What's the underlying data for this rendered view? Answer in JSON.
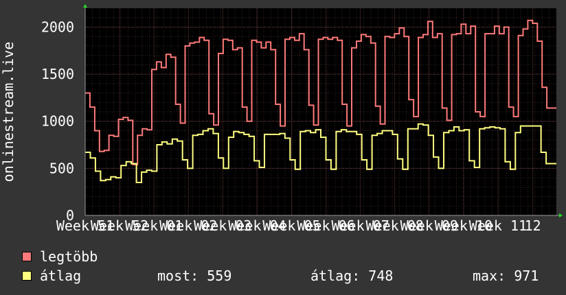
{
  "chart_data": {
    "type": "line",
    "ylabel": "onlinestream.live",
    "ylim": [
      0,
      2200
    ],
    "yticks": [
      0,
      500,
      1000,
      1500,
      2000
    ],
    "xlim": [
      0,
      100
    ],
    "xtick_labels": [
      "Week 51",
      "Week 52",
      "Week 01",
      "Week 02",
      "Week 03",
      "Week 04",
      "Week 05",
      "Week 06",
      "Week 07",
      "Week 08",
      "Week 09",
      "Week 10",
      "Week 11",
      "12"
    ],
    "xtick_positions": [
      0,
      7.3,
      14.6,
      21.9,
      29.2,
      36.5,
      43.8,
      51.1,
      58.4,
      65.7,
      73.0,
      80.3,
      87.6,
      95
    ],
    "grid": true,
    "series": [
      {
        "name": "legtöbb",
        "color": "#ff7a7a",
        "values": [
          1300,
          1150,
          900,
          680,
          690,
          850,
          840,
          1020,
          1040,
          1010,
          540,
          850,
          920,
          910,
          1550,
          1630,
          1570,
          1710,
          1680,
          1180,
          980,
          1800,
          1830,
          1840,
          1890,
          1860,
          1080,
          960,
          1720,
          1870,
          1860,
          1760,
          1780,
          1150,
          1000,
          1860,
          1840,
          1780,
          1840,
          1760,
          1180,
          950,
          1870,
          1890,
          1860,
          1930,
          1760,
          1170,
          960,
          1870,
          1890,
          1870,
          1890,
          1860,
          1180,
          950,
          1780,
          1850,
          1920,
          1900,
          1830,
          1160,
          970,
          1900,
          1890,
          1930,
          1990,
          1900,
          1230,
          1050,
          1890,
          1920,
          2060,
          1890,
          1930,
          1140,
          1010,
          1920,
          1930,
          2030,
          1930,
          2010,
          1100,
          1050,
          1930,
          1930,
          2010,
          1930,
          2000,
          1150,
          1050,
          1910,
          1980,
          2070,
          2040,
          1850,
          1360,
          1140,
          1140
        ]
      },
      {
        "name": "átlag",
        "color": "#ffff80",
        "values": [
          670,
          610,
          470,
          370,
          380,
          410,
          400,
          530,
          570,
          550,
          350,
          460,
          480,
          470,
          750,
          780,
          760,
          810,
          790,
          590,
          500,
          850,
          860,
          900,
          920,
          870,
          610,
          500,
          830,
          890,
          880,
          860,
          840,
          580,
          510,
          860,
          860,
          860,
          870,
          820,
          590,
          490,
          890,
          900,
          880,
          910,
          830,
          590,
          490,
          890,
          910,
          890,
          890,
          860,
          590,
          490,
          850,
          870,
          900,
          900,
          860,
          600,
          490,
          920,
          920,
          970,
          960,
          850,
          620,
          500,
          880,
          900,
          940,
          900,
          910,
          580,
          510,
          920,
          930,
          940,
          930,
          920,
          570,
          490,
          880,
          950,
          950,
          950,
          950,
          670,
          550,
          550
        ]
      }
    ]
  },
  "legend": [
    {
      "label": "legtöbb",
      "color": "#ff7a7a"
    },
    {
      "label": "átlag",
      "color": "#ffff80"
    }
  ],
  "stats": {
    "most": "most: 559",
    "atlag": "átlag: 748",
    "max": "max: 971"
  }
}
